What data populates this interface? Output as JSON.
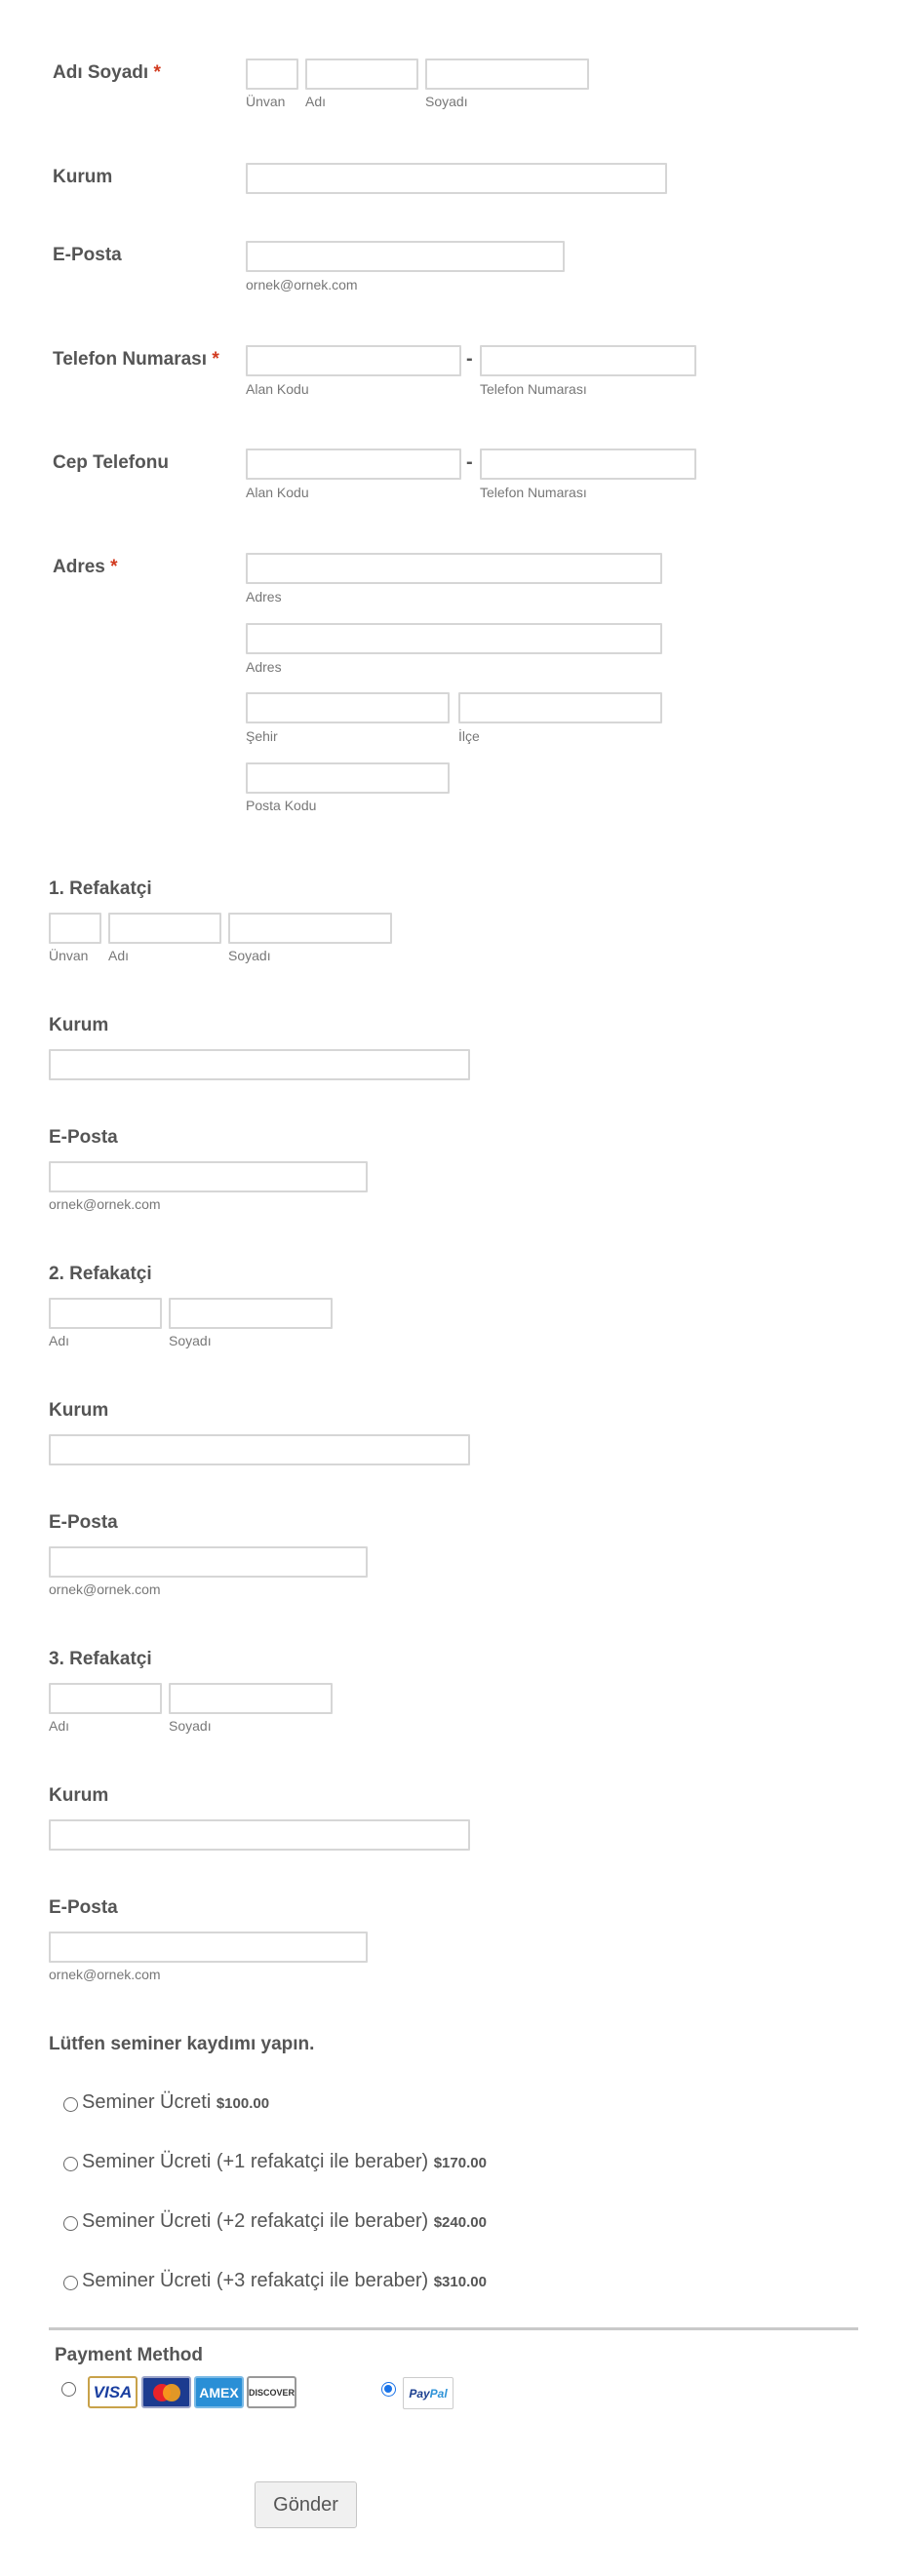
{
  "main_contact": {
    "name_label": "Adı Soyadı",
    "required_mark": "*",
    "title_sub": "Ünvan",
    "first_sub": "Adı",
    "last_sub": "Soyadı",
    "org_label": "Kurum",
    "email_label": "E-Posta",
    "email_sub": "ornek@ornek.com",
    "phone_label": "Telefon Numarası",
    "mobile_label": "Cep Telefonu",
    "area_sub": "Alan Kodu",
    "number_sub": "Telefon Numarası",
    "dash": "-",
    "address_label": "Adres",
    "address_sub": "Adres",
    "city_sub": "Şehir",
    "district_sub": "İlçe",
    "postal_sub": "Posta Kodu"
  },
  "companions": [
    {
      "heading": "1. Refakatçi",
      "title_sub": "Ünvan",
      "first_sub": "Adı",
      "last_sub": "Soyadı",
      "org_label": "Kurum",
      "email_label": "E-Posta",
      "email_sub": "ornek@ornek.com"
    },
    {
      "heading": "2. Refakatçi",
      "first_sub": "Adı",
      "last_sub": "Soyadı",
      "org_label": "Kurum",
      "email_label": "E-Posta",
      "email_sub": "ornek@ornek.com"
    },
    {
      "heading": "3. Refakatçi",
      "first_sub": "Adı",
      "last_sub": "Soyadı",
      "org_label": "Kurum",
      "email_label": "E-Posta",
      "email_sub": "ornek@ornek.com"
    }
  ],
  "registration": {
    "question": "Lütfen seminer kaydımı yapın.",
    "options": [
      {
        "label": "Seminer Ücreti",
        "price": "$100.00"
      },
      {
        "label": "Seminer Ücreti (+1 refakatçi ile beraber)",
        "price": "$170.00"
      },
      {
        "label": "Seminer Ücreti (+2 refakatçi ile beraber)",
        "price": "$240.00"
      },
      {
        "label": "Seminer Ücreti (+3 refakatçi ile beraber)",
        "price": "$310.00"
      }
    ]
  },
  "payment": {
    "label": "Payment Method",
    "cards": [
      "VISA",
      "MasterCard",
      "AMEX",
      "DISCOVER"
    ],
    "paypal_a": "Pay",
    "paypal_b": "Pal",
    "selected": "paypal"
  },
  "submit_label": "Gönder",
  "colors": {
    "required": "#d13a1f",
    "radio_selected": "#1a73e8",
    "input_border": "#d6d6d6"
  }
}
